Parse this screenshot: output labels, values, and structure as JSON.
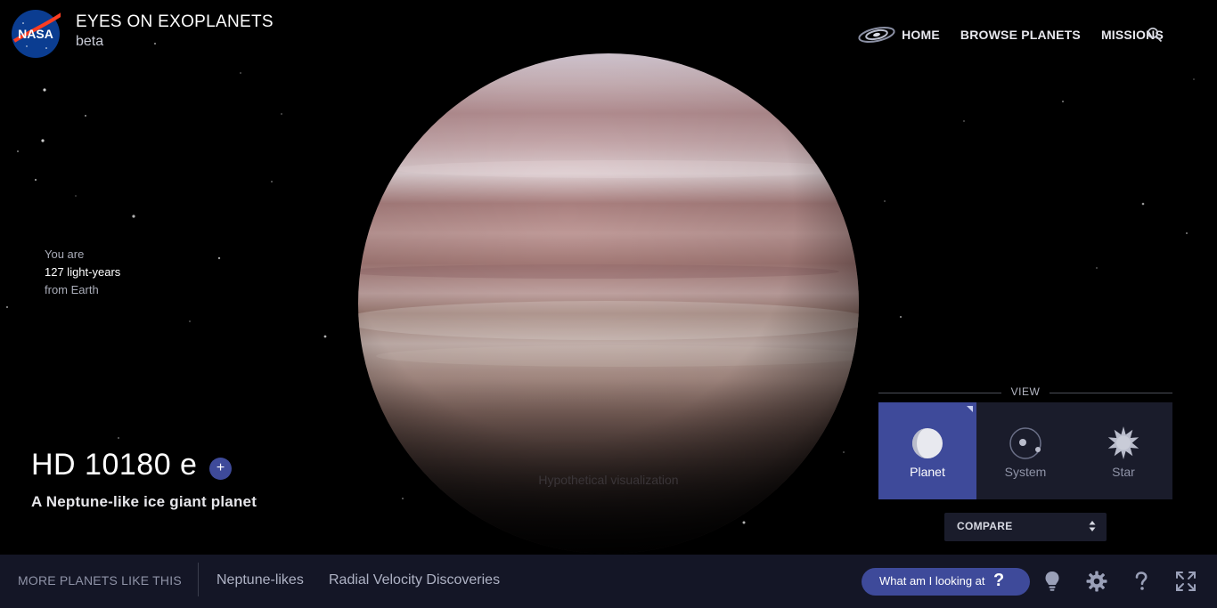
{
  "header": {
    "brand_title": "EYES ON EXOPLANETS",
    "brand_subtitle": "beta",
    "logo_text": "NASA",
    "nav": [
      {
        "label": "HOME"
      },
      {
        "label": "BROWSE PLANETS"
      },
      {
        "label": "MISSIONS"
      }
    ]
  },
  "distance": {
    "line1": "You are",
    "line2": "127 light-years",
    "line3": "from Earth"
  },
  "planet": {
    "name": "HD 10180 e",
    "add_symbol": "+",
    "description": "A Neptune-like ice giant planet",
    "visualization_note": "Hypothetical visualization"
  },
  "view": {
    "label": "VIEW",
    "options": [
      {
        "label": "Planet",
        "icon": "planet-icon",
        "active": true
      },
      {
        "label": "System",
        "icon": "system-icon",
        "active": false
      },
      {
        "label": "Star",
        "icon": "star-icon",
        "active": false
      }
    ]
  },
  "compare": {
    "label": "COMPARE"
  },
  "bottom_bar": {
    "more_label": "MORE PLANETS LIKE THIS",
    "tags": [
      "Neptune-likes",
      "Radial Velocity Discoveries"
    ],
    "what_am_i_looking_at": "What am I looking at",
    "question_mark": "?"
  },
  "colors": {
    "accent": "#3e4a9a",
    "panel": "#1a1c2b",
    "bottom_bar": "#141626"
  }
}
